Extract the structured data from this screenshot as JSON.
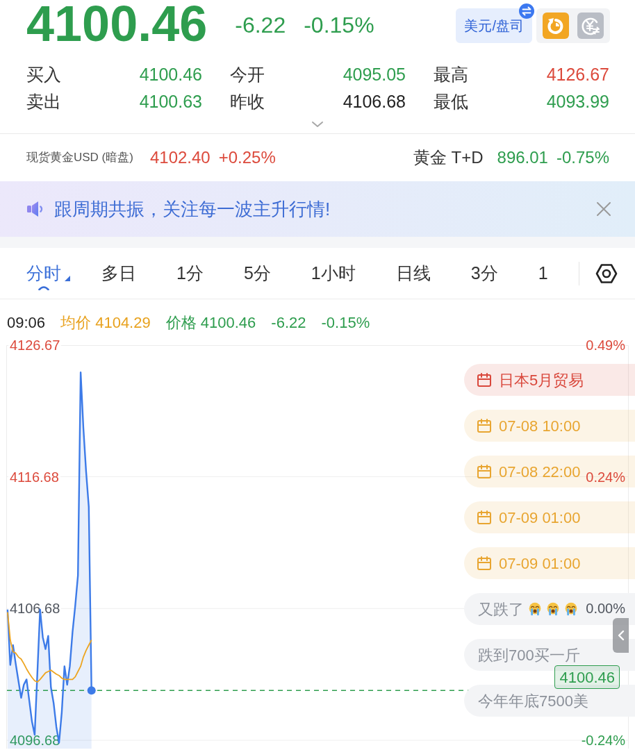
{
  "quote": {
    "price": "4100.46",
    "change": "-6.22",
    "change_percent": "-0.15%",
    "color": "#2e9d4e"
  },
  "unit_button": {
    "label": "美元/盘司"
  },
  "stats": [
    {
      "label": "买入",
      "value": "4100.46",
      "color": "#2e9d4e"
    },
    {
      "label": "今开",
      "value": "4095.05",
      "color": "#2e9d4e"
    },
    {
      "label": "最高",
      "value": "4126.67",
      "color": "#dc4a3c"
    },
    {
      "label": "卖出",
      "value": "4100.63",
      "color": "#2e9d4e"
    },
    {
      "label": "昨收",
      "value": "4106.68",
      "color": "#222222"
    },
    {
      "label": "最低",
      "value": "4093.99",
      "color": "#2e9d4e"
    }
  ],
  "related_quotes": [
    {
      "name": "现货黄金USD (暗盘)",
      "price": "4102.40",
      "change_percent": "+0.25%",
      "color": "#dc4a3c"
    },
    {
      "name": "黄金 T+D",
      "price": "896.01",
      "change_percent": "-0.75%",
      "color": "#2e9d4e"
    }
  ],
  "banner": {
    "text": "跟周期共振，关注每一波主升行情!"
  },
  "tabs": [
    {
      "label": "分时",
      "selected": true,
      "dropdown": true
    },
    {
      "label": "多日",
      "selected": false,
      "dropdown": false
    },
    {
      "label": "1分",
      "selected": false,
      "dropdown": false
    },
    {
      "label": "5分",
      "selected": false,
      "dropdown": false
    },
    {
      "label": "1小时",
      "selected": false,
      "dropdown": false
    },
    {
      "label": "日线",
      "selected": false,
      "dropdown": false
    },
    {
      "label": "3分",
      "selected": false,
      "dropdown": false
    },
    {
      "label": "1",
      "selected": false,
      "dropdown": false
    }
  ],
  "info_bar": [
    {
      "text": "09:06",
      "color": "#222222"
    },
    {
      "text": "均价 4104.29",
      "color": "#e8a21f"
    },
    {
      "text": "价格 4100.46",
      "color": "#2e9d4e"
    },
    {
      "text": "-6.22",
      "color": "#2e9d4e"
    },
    {
      "text": "-0.15%",
      "color": "#2e9d4e"
    }
  ],
  "chart": {
    "chart_data": {
      "type": "line",
      "grid": true,
      "categories": [
        null,
        null,
        null,
        null,
        null,
        null,
        null,
        null,
        null,
        null,
        null,
        null,
        null,
        null,
        null,
        null,
        null,
        null,
        null,
        null,
        null,
        null,
        null,
        null,
        null,
        null,
        null,
        null,
        null,
        null,
        null,
        null,
        null,
        null,
        null,
        null,
        null,
        null,
        null,
        null,
        null,
        null,
        null,
        null,
        null,
        null,
        null,
        null,
        null,
        null,
        null,
        null,
        null,
        null,
        null,
        null,
        null,
        null,
        null,
        null,
        null,
        null,
        null,
        null,
        null,
        null,
        null,
        null,
        null,
        null,
        null,
        null,
        null,
        null,
        null,
        null,
        null,
        null,
        null,
        null,
        null,
        null,
        null,
        null,
        null,
        null,
        null,
        null,
        null,
        null,
        null,
        null,
        null,
        null,
        null,
        null,
        null,
        null,
        null,
        null,
        null,
        null,
        null,
        null,
        null,
        null,
        null,
        null,
        null,
        null,
        null,
        null,
        null,
        null,
        null,
        null,
        null,
        null,
        null,
        null,
        null,
        null,
        null,
        null,
        null,
        null,
        null,
        null,
        null,
        null,
        null,
        null,
        null,
        null,
        null,
        null,
        null,
        null,
        null,
        null,
        null,
        null,
        null,
        null,
        null,
        null,
        null,
        null,
        null,
        null,
        null,
        null,
        null,
        null,
        null,
        null,
        null,
        null,
        null,
        null,
        null,
        null,
        null,
        null,
        null,
        null,
        null,
        null,
        null,
        null,
        null,
        null,
        null,
        null,
        null,
        null,
        null,
        null,
        null,
        null,
        null,
        null,
        null,
        null,
        null,
        null,
        null,
        null,
        null,
        null,
        null,
        null,
        null,
        null,
        null,
        null,
        null,
        null,
        null,
        null,
        null,
        null,
        null,
        null,
        null,
        null,
        null,
        null,
        null,
        null,
        null,
        null,
        null,
        null,
        null,
        null,
        null,
        null,
        null,
        null,
        null,
        null,
        null,
        null,
        null,
        null,
        null,
        null,
        null,
        null
      ],
      "series": [
        {
          "color": "#3d7be8",
          "values": [
            4106.6,
            4102.4,
            4103.9,
            4102.5,
            4101.2,
            4099.9,
            4100.9,
            4101.3,
            4099.7,
            4098.1,
            4097.1,
            4101.8,
            4106.6,
            4104.5,
            4103.6,
            4104.6,
            4100.7,
            4099.5,
            4097.7,
            4096.5,
            4098.8,
            4102.3,
            4100.9,
            4102.3,
            4104.9,
            4106.9,
            4109.2,
            4124.6,
            4120.4,
            4117.1,
            4114.4,
            4100.46,
            null,
            null,
            null,
            null,
            null,
            null,
            null,
            null,
            null,
            null,
            null,
            null,
            null,
            null,
            null,
            null,
            null,
            null,
            null,
            null,
            null,
            null,
            null,
            null,
            null,
            null,
            null,
            null,
            null,
            null,
            null,
            null,
            null,
            null,
            null,
            null,
            null,
            null,
            null,
            null,
            null,
            null,
            null,
            null,
            null,
            null,
            null,
            null,
            null,
            null,
            null,
            null,
            null,
            null,
            null,
            null,
            null,
            null,
            null,
            null,
            null,
            null,
            null,
            null,
            null,
            null,
            null,
            null,
            null,
            null,
            null,
            null,
            null,
            null,
            null,
            null,
            null,
            null,
            null,
            null,
            null,
            null,
            null,
            null,
            null,
            null,
            null,
            null,
            null,
            null,
            null,
            null,
            null,
            null,
            null,
            null,
            null,
            null,
            null,
            null,
            null,
            null,
            null,
            null,
            null,
            null,
            null,
            null,
            null,
            null,
            null,
            null,
            null,
            null,
            null,
            null,
            null,
            null,
            null,
            null,
            null,
            null,
            null,
            null,
            null,
            null,
            null,
            null,
            null,
            null,
            null,
            null,
            null,
            null,
            null,
            null,
            null,
            null,
            null,
            null,
            null,
            null,
            null,
            null,
            null,
            null,
            null,
            null,
            null,
            null,
            null,
            null,
            null,
            null,
            null,
            null,
            null,
            null,
            null,
            null,
            null,
            null,
            null,
            null,
            null,
            null,
            null,
            null,
            null,
            null,
            null,
            null,
            null,
            null,
            null,
            null,
            null,
            null,
            null,
            null,
            null,
            null,
            null,
            null,
            null,
            null,
            null,
            null,
            null,
            null,
            null,
            null,
            null,
            null,
            null,
            null,
            null,
            null
          ]
        },
        {
          "color": "#eda520",
          "values": [
            4106.4,
            4104.3,
            4103.4,
            4103.3,
            4103.0,
            4102.85,
            4102.5,
            4102.1,
            4101.75,
            4101.45,
            4101.2,
            4101.1,
            4101.3,
            4101.55,
            4101.8,
            4101.9,
            4102.0,
            4101.85,
            4101.7,
            4101.6,
            4101.4,
            4101.3,
            4101.3,
            4101.3,
            4101.3,
            4101.5,
            4101.9,
            4102.3,
            4103.0,
            4103.5,
            4103.9,
            4104.29,
            null,
            null,
            null,
            null,
            null,
            null,
            null,
            null,
            null,
            null,
            null,
            null,
            null,
            null,
            null,
            null,
            null,
            null,
            null,
            null,
            null,
            null,
            null,
            null,
            null,
            null,
            null,
            null,
            null,
            null,
            null,
            null,
            null,
            null,
            null,
            null,
            null,
            null,
            null,
            null,
            null,
            null,
            null,
            null,
            null,
            null,
            null,
            null,
            null,
            null,
            null,
            null,
            null,
            null,
            null,
            null,
            null,
            null,
            null,
            null,
            null,
            null,
            null,
            null,
            null,
            null,
            null,
            null,
            null,
            null,
            null,
            null,
            null,
            null,
            null,
            null,
            null,
            null,
            null,
            null,
            null,
            null,
            null,
            null,
            null,
            null,
            null,
            null,
            null,
            null,
            null,
            null,
            null,
            null,
            null,
            null,
            null,
            null,
            null,
            null,
            null,
            null,
            null,
            null,
            null,
            null,
            null,
            null,
            null,
            null,
            null,
            null,
            null,
            null,
            null,
            null,
            null,
            null,
            null,
            null,
            null,
            null,
            null,
            null,
            null,
            null,
            null,
            null,
            null,
            null,
            null,
            null,
            null,
            null,
            null,
            null,
            null,
            null,
            null,
            null,
            null,
            null,
            null,
            null,
            null,
            null,
            null,
            null,
            null,
            null,
            null,
            null,
            null,
            null,
            null,
            null,
            null,
            null,
            null,
            null,
            null,
            null,
            null,
            null,
            null,
            null,
            null,
            null,
            null,
            null,
            null,
            null,
            null,
            null,
            null,
            null,
            null,
            null,
            null,
            null,
            null,
            null,
            null,
            null,
            null,
            null,
            null,
            null,
            null,
            null,
            null,
            null,
            null,
            null,
            null,
            null,
            null,
            null
          ]
        }
      ],
      "ylim": [
        4096.05,
        4126.67
      ],
      "yticks": [
        {
          "value": 4126.67,
          "label": "4126.67"
        },
        {
          "value": 4116.68,
          "label": "4116.68"
        },
        {
          "value": 4106.68,
          "label": "4106.68"
        },
        {
          "value": 4096.68,
          "label": "4096.68"
        }
      ],
      "ref_lines": [
        {
          "axis": "y",
          "value": 4100.46,
          "label": "4100.46",
          "color": "#2e9d4e"
        }
      ]
    },
    "percent_ticks": [
      {
        "label": "0.49%",
        "color": "#dc4a3c"
      },
      {
        "label": "0.24%",
        "color": "#dc4a3c"
      },
      {
        "label": "0.00%",
        "color": "#50555e"
      },
      {
        "label": "-0.24%",
        "color": "#2e9d4e"
      }
    ],
    "events": [
      {
        "kind": "event",
        "text": "日本5月贸易",
        "color": "#d9473b"
      },
      {
        "kind": "event",
        "text": "07-08 10:00",
        "color": "#e8a530"
      },
      {
        "kind": "event",
        "text": "07-08 22:00",
        "color": "#e8a530"
      },
      {
        "kind": "event",
        "text": "07-09 01:00",
        "color": "#e8a530"
      },
      {
        "kind": "event",
        "text": "07-09 01:00",
        "color": "#e8a530"
      },
      {
        "kind": "comment",
        "text": "又跌了",
        "reactions": [
          {
            "kind": "crying-face"
          },
          {
            "kind": "crying-face"
          },
          {
            "kind": "crying-face"
          }
        ]
      },
      {
        "kind": "comment",
        "text": "跌到700买一斤"
      },
      {
        "kind": "comment",
        "text": "今年年底7500美"
      }
    ]
  }
}
